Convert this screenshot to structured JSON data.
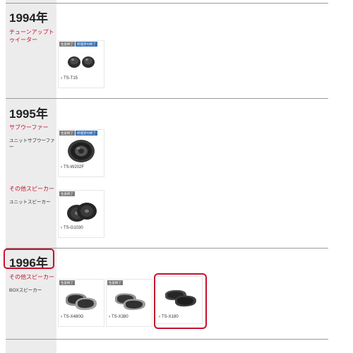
{
  "colors": {
    "accent": "#c8102e",
    "badge_end": "#7b7b7b",
    "badge_repair": "#3a6fb5",
    "sidebar_bg": "#ececec"
  },
  "sections": [
    {
      "year": "1994年",
      "groups": [
        {
          "category": "チューンアップトゥイーター",
          "subcategory": "",
          "products": [
            {
              "model": "TS-T15",
              "badges": [
                "生産終了",
                "修理受付終了"
              ],
              "image": "tweeter-pair"
            }
          ]
        }
      ]
    },
    {
      "year": "1995年",
      "groups": [
        {
          "category": "サブウーファー",
          "subcategory": "ユニットサブウーファー",
          "products": [
            {
              "model": "TS-W202F",
              "badges": [
                "生産終了",
                "修理受付終了"
              ],
              "image": "subwoofer-unit"
            }
          ]
        },
        {
          "category": "その他スピーカー",
          "subcategory": "ユニットスピーカー",
          "products": [
            {
              "model": "TS-G1030",
              "badges": [
                "生産終了"
              ],
              "image": "speaker-pair"
            }
          ]
        }
      ]
    },
    {
      "year": "1996年",
      "groups": [
        {
          "category": "その他スピーカー",
          "subcategory": "BOXスピーカー",
          "products": [
            {
              "model": "TS-X480G",
              "badges": [
                "生産終了"
              ],
              "image": "box-speaker-silver"
            },
            {
              "model": "TS-X380",
              "badges": [
                "生産終了"
              ],
              "image": "box-speaker-silver"
            },
            {
              "model": "TS-X180",
              "badges": [],
              "image": "box-speaker-dark"
            }
          ]
        }
      ]
    }
  ]
}
